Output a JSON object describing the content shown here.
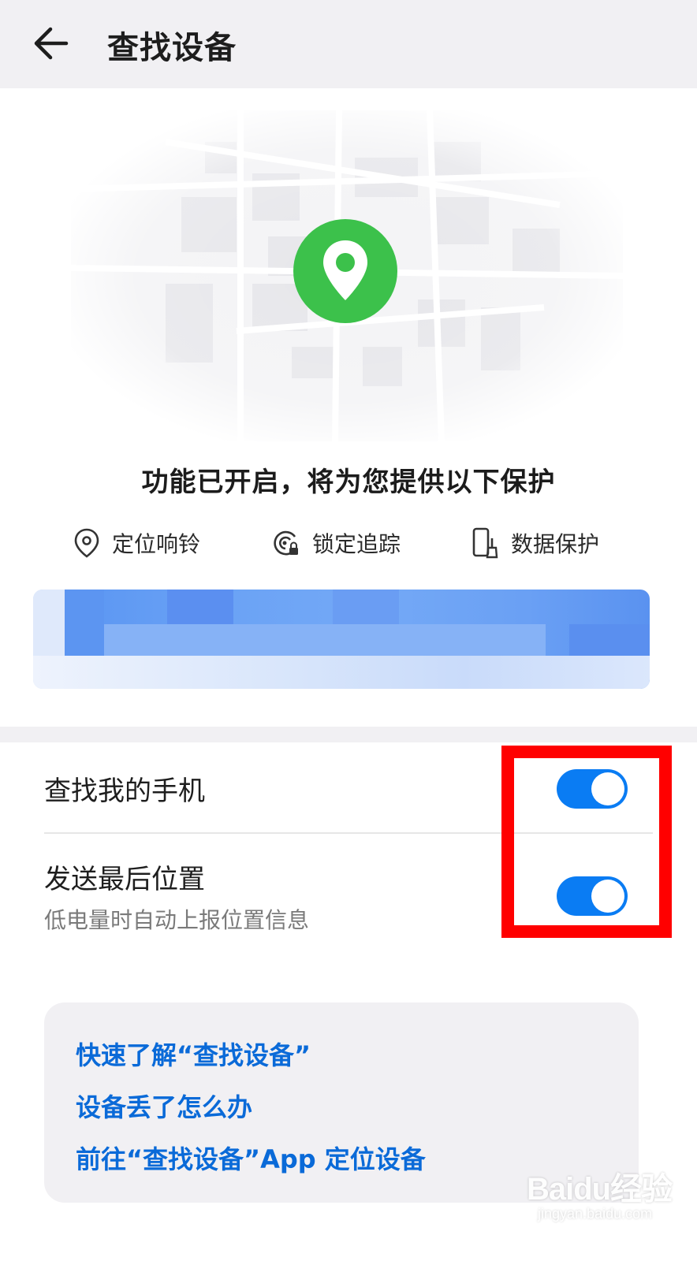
{
  "header": {
    "title": "查找设备",
    "back_icon": "arrow-left-icon"
  },
  "illustration": {
    "pin_icon": "location-pin-icon",
    "pin_color": "#3cc14b"
  },
  "headline": "功能已开启，将为您提供以下保护",
  "features": [
    {
      "icon": "location-pin-outline-icon",
      "label": "定位响铃"
    },
    {
      "icon": "lock-radar-icon",
      "label": "锁定追踪"
    },
    {
      "icon": "phone-brush-icon",
      "label": "数据保护"
    }
  ],
  "settings": {
    "find_phone": {
      "label": "查找我的手机",
      "enabled": true
    },
    "send_last_location": {
      "label": "发送最后位置",
      "sublabel": "低电量时自动上报位置信息",
      "enabled": true
    }
  },
  "help_links": [
    "快速了解“查找设备”",
    "设备丢了怎么办",
    "前往“查找设备”App 定位设备"
  ],
  "watermark": {
    "logo": "Baidu经验",
    "url": "jingyan.baidu.com"
  },
  "colors": {
    "accent": "#0a7cf3",
    "link": "#0a6ad8",
    "highlight": "#ff0000"
  }
}
